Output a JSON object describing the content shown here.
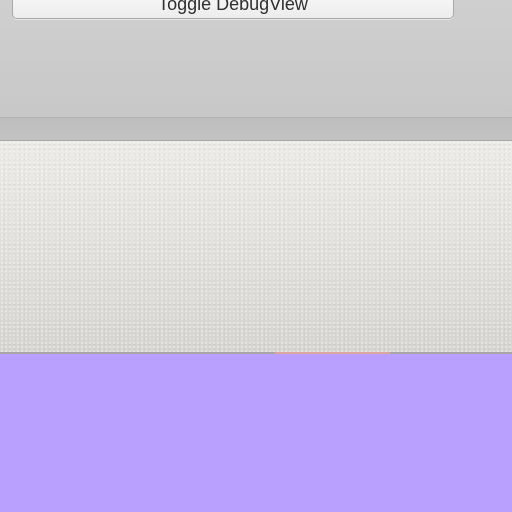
{
  "toolbar": {
    "debug_button_label": "Toggle DebugView"
  },
  "colors": {
    "top_panel": "#cbcbcb",
    "divider": "#c0c0c0",
    "texture_panel": "#e2e1de",
    "content_area": "#b9a0ff",
    "accent_line": "#d9a6a0"
  }
}
